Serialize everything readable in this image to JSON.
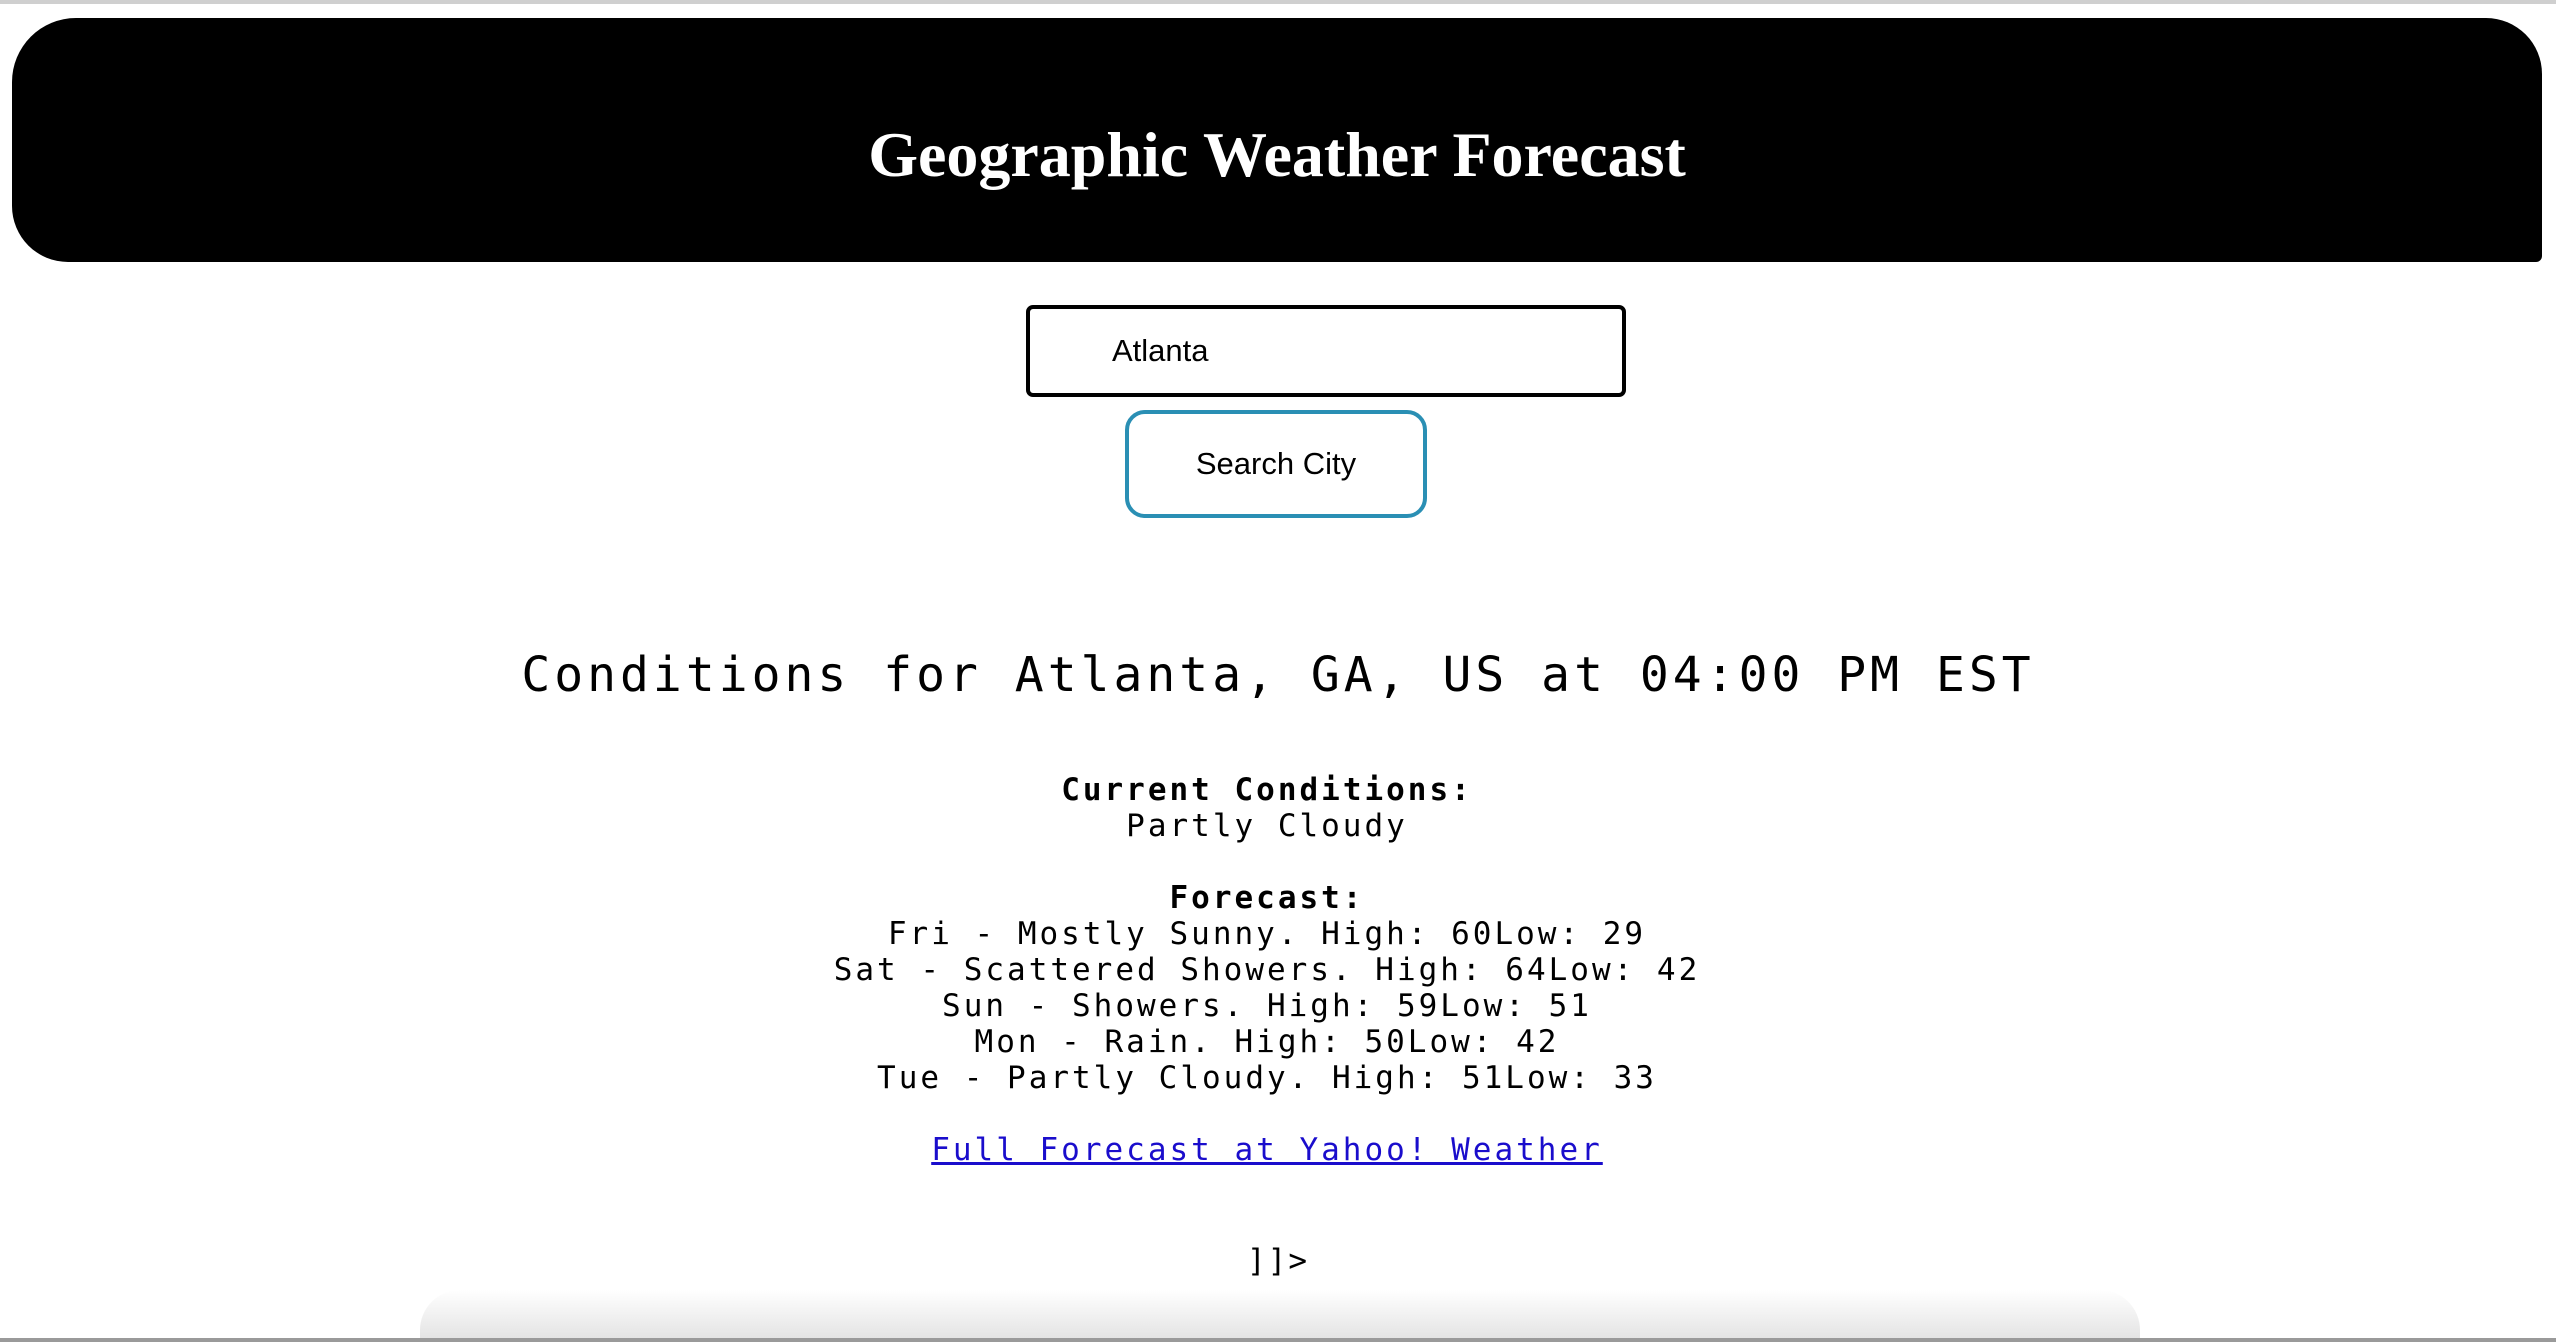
{
  "header": {
    "title": "Geographic Weather Forecast"
  },
  "search": {
    "value": "Atlanta",
    "button_label": "Search City"
  },
  "results": {
    "heading": "Conditions for Atlanta, GA, US at 04:00 PM EST",
    "current_label": "Current Conditions:",
    "current_value": "Partly Cloudy",
    "forecast_label": "Forecast:",
    "forecast": [
      "Fri - Mostly Sunny. High: 60Low: 29",
      "Sat - Scattered Showers. High: 64Low: 42",
      "Sun - Showers. High: 59Low: 51",
      "Mon - Rain. High: 50Low: 42",
      "Tue - Partly Cloudy. High: 51Low: 33"
    ],
    "link_text": "Full Forecast at Yahoo! Weather"
  },
  "trailing_text": "]]>",
  "colors": {
    "header_bg": "#000000",
    "header_text": "#ffffff",
    "button_border": "#2a8fb4",
    "link": "#1a0dcc"
  }
}
